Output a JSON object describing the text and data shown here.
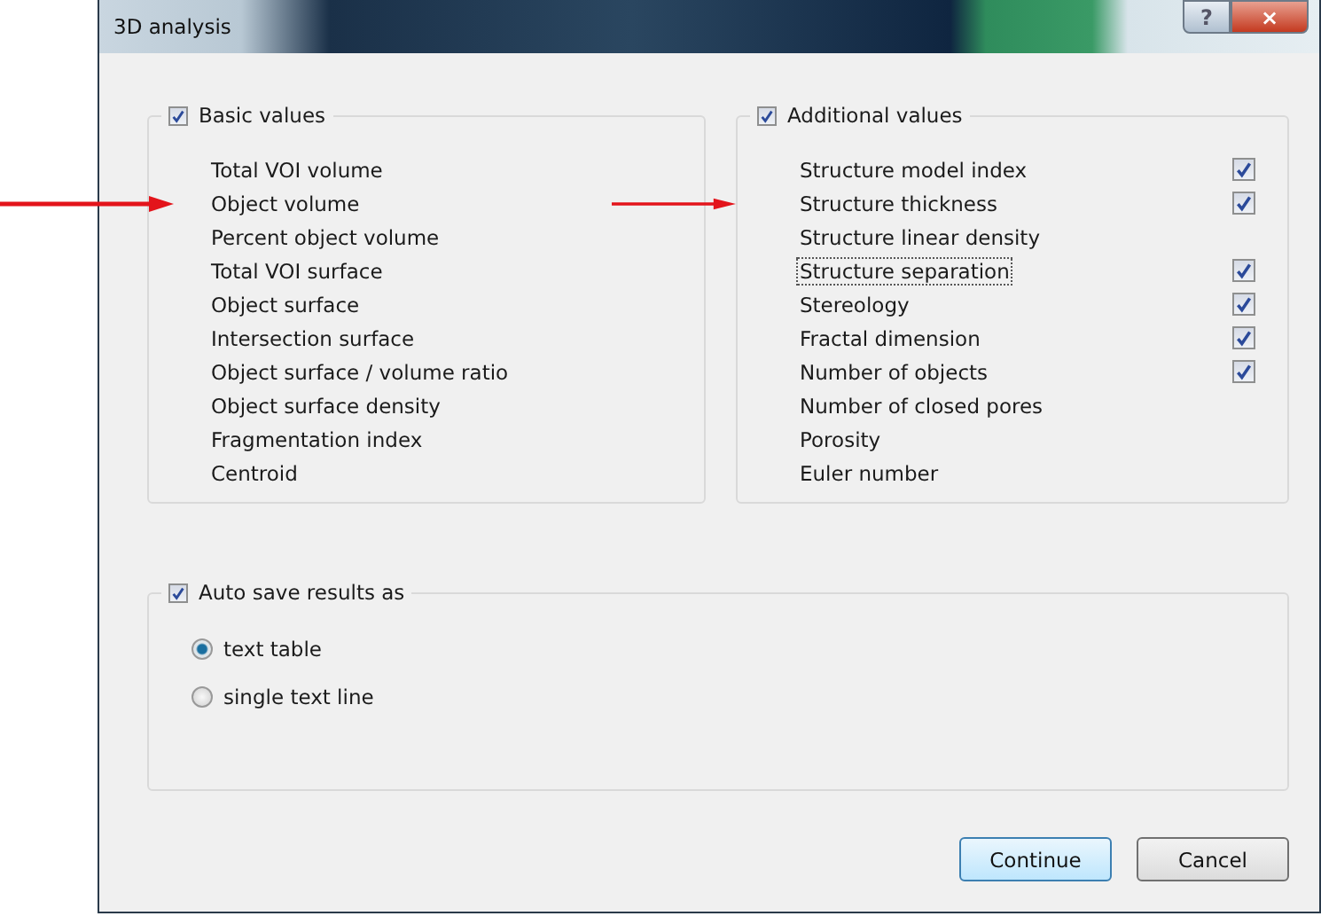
{
  "window": {
    "title": "3D analysis",
    "help_button": "?",
    "close_button": "×"
  },
  "basic_values": {
    "label": "Basic values",
    "checked": true,
    "items": [
      {
        "label": "Total VOI volume",
        "marked": false
      },
      {
        "label": "Object volume",
        "marked": true
      },
      {
        "label": "Percent object volume",
        "marked": false
      },
      {
        "label": "Total VOI surface",
        "marked": false
      },
      {
        "label": "Object surface",
        "marked": false
      },
      {
        "label": "Intersection surface",
        "marked": false
      },
      {
        "label": "Object surface / volume ratio",
        "marked": false
      },
      {
        "label": "Object surface density",
        "marked": false
      },
      {
        "label": "Fragmentation index",
        "marked": false
      },
      {
        "label": "Centroid",
        "marked": false
      }
    ]
  },
  "additional_values": {
    "label": "Additional values",
    "checked": true,
    "items": [
      {
        "label": "Structure model index",
        "kind": "checkable",
        "checked": true,
        "focused": false,
        "marked": false
      },
      {
        "label": "Structure thickness",
        "kind": "checkable",
        "checked": true,
        "focused": false,
        "marked": true
      },
      {
        "label": "Structure linear density",
        "kind": "plain",
        "focused": false,
        "marked": false
      },
      {
        "label": "Structure separation",
        "kind": "checkable",
        "checked": true,
        "focused": true,
        "marked": false
      },
      {
        "label": "Stereology",
        "kind": "checkable",
        "checked": true,
        "focused": false,
        "marked": false
      },
      {
        "label": "Fractal dimension",
        "kind": "checkable",
        "checked": true,
        "focused": false,
        "marked": false
      },
      {
        "label": "Number of objects",
        "kind": "checkable",
        "checked": true,
        "focused": false,
        "marked": false
      },
      {
        "label": "Number of closed pores",
        "kind": "plain",
        "focused": false,
        "marked": false
      },
      {
        "label": "Porosity",
        "kind": "plain",
        "focused": false,
        "marked": false
      },
      {
        "label": "Euler number",
        "kind": "plain",
        "focused": false,
        "marked": false
      }
    ]
  },
  "auto_save": {
    "label": "Auto save results as",
    "checked": true,
    "options": [
      {
        "label": "text table",
        "selected": true
      },
      {
        "label": "single text line",
        "selected": false
      }
    ]
  },
  "buttons": [
    {
      "label": "Continue",
      "default": true
    },
    {
      "label": "Cancel",
      "default": false
    }
  ]
}
